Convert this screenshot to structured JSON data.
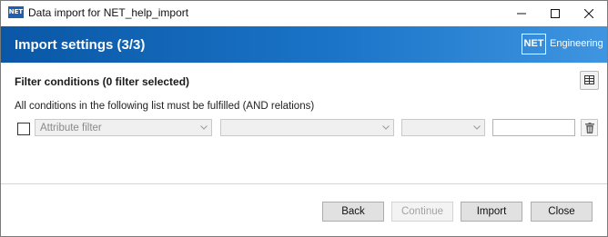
{
  "window": {
    "title": "Data import for NET_help_import",
    "app_icon_text": "NET"
  },
  "header": {
    "title": "Import settings (3/3)",
    "logo_box_text": "NET",
    "logo_text": "Engineering"
  },
  "filter": {
    "section_title": "Filter conditions (0 filter selected)",
    "hint": "All conditions in the following list must be fulfilled (AND relations)",
    "row": {
      "checked": false,
      "attribute_value": "Attribute filter",
      "operator_value": "",
      "modifier_value": "",
      "text_value": ""
    }
  },
  "buttons": {
    "back": "Back",
    "continue": "Continue",
    "import": "Import",
    "close": "Close"
  },
  "colors": {
    "header_start": "#0a57a6",
    "header_end": "#3f95e0"
  }
}
